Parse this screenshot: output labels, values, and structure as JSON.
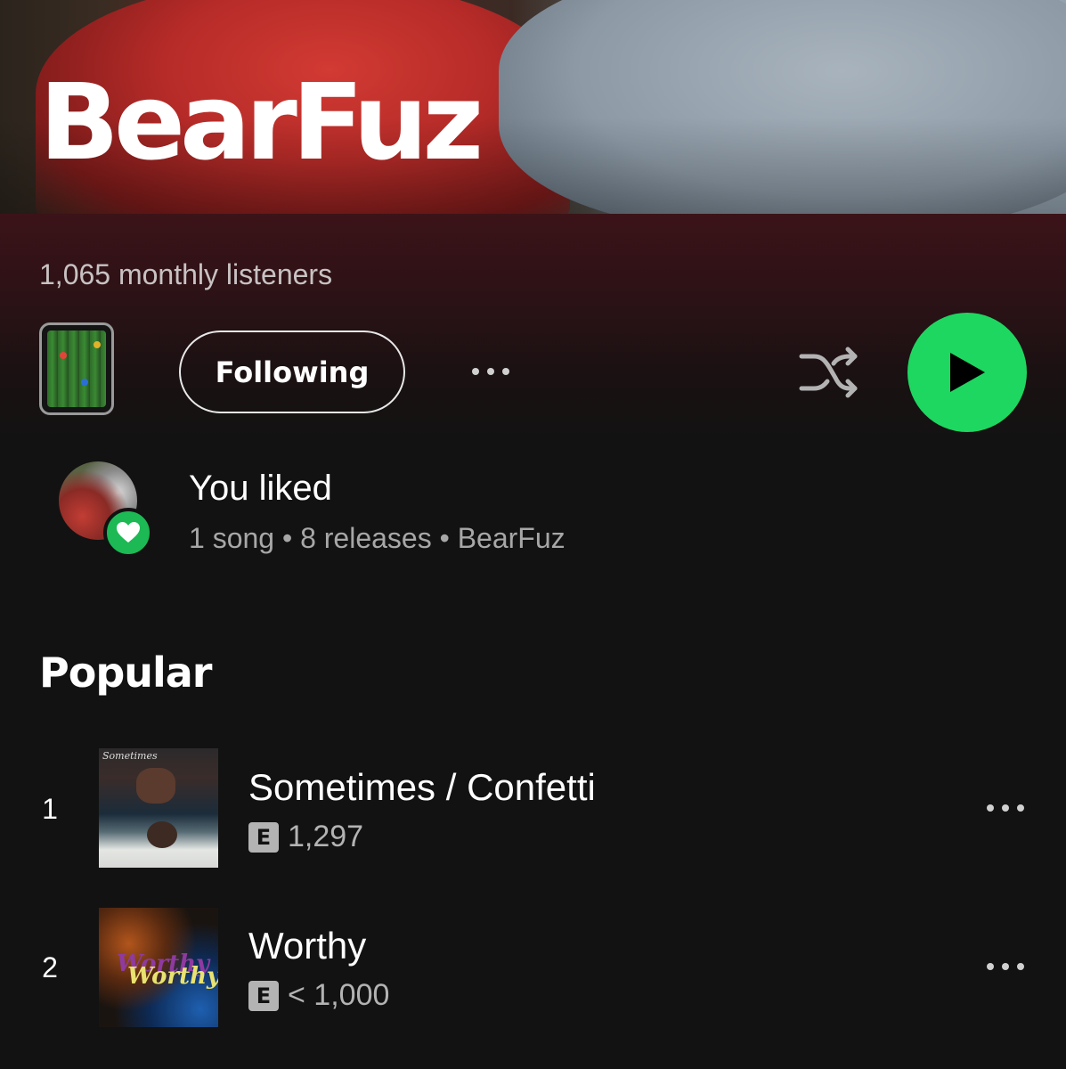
{
  "artist": {
    "name": "BearFuz",
    "monthly_listeners": "1,065 monthly listeners"
  },
  "actions": {
    "follow_label": "Following",
    "colors": {
      "play_button": "#1ed760",
      "accent_green": "#1db954"
    },
    "icons": [
      "mini-cover-art",
      "more-options-icon",
      "shuffle-icon",
      "play-icon"
    ]
  },
  "liked": {
    "title": "You liked",
    "subtitle": "1 song • 8 releases • BearFuz",
    "icons": [
      "liked-artist-avatar",
      "heart-icon"
    ]
  },
  "popular": {
    "title": "Popular",
    "tracks": [
      {
        "rank": "1",
        "title": "Sometimes / Confetti",
        "explicit": "E",
        "plays": "1,297",
        "cover_text": "Sometimes"
      },
      {
        "rank": "2",
        "title": "Worthy",
        "explicit": "E",
        "plays": "< 1,000",
        "cover_text": "Worthy"
      }
    ]
  }
}
